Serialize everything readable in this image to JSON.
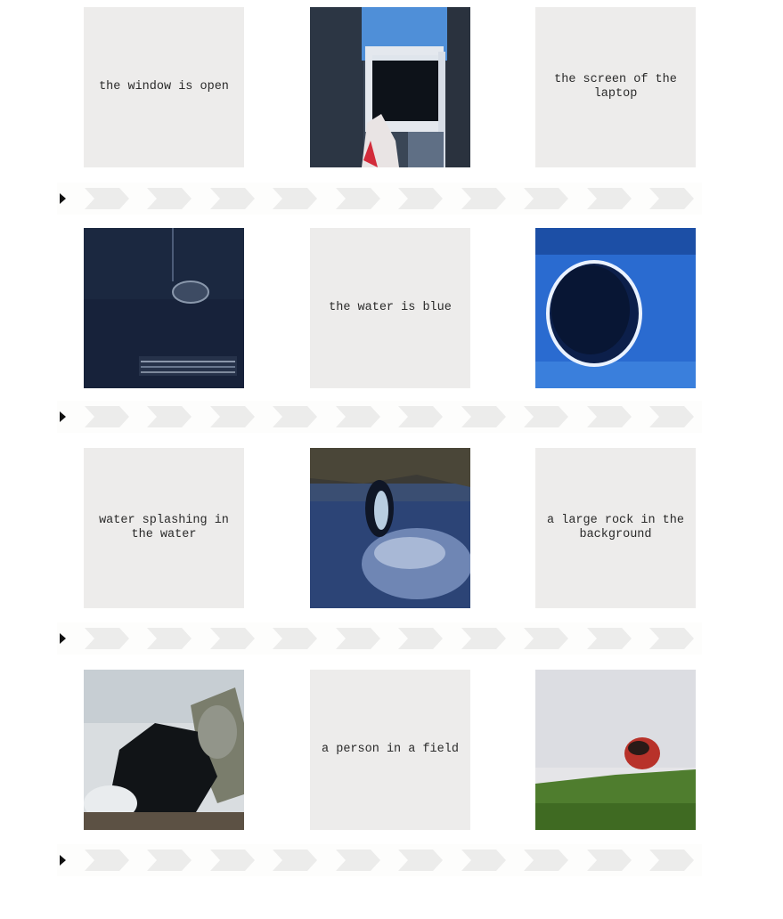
{
  "rows": [
    {
      "tiles": [
        {
          "kind": "text",
          "caption": "the window is open"
        },
        {
          "kind": "image",
          "image": "window-image"
        },
        {
          "kind": "text",
          "caption": "the screen of the\nlaptop"
        }
      ]
    },
    {
      "tiles": [
        {
          "kind": "image",
          "image": "dark-water-image"
        },
        {
          "kind": "text",
          "caption": "the water is blue"
        },
        {
          "kind": "image",
          "image": "blue-hole-image"
        }
      ]
    },
    {
      "tiles": [
        {
          "kind": "text",
          "caption": "water splashing in\nthe water"
        },
        {
          "kind": "image",
          "image": "bird-water-image"
        },
        {
          "kind": "text",
          "caption": "a large rock in the\nbackground"
        }
      ]
    },
    {
      "tiles": [
        {
          "kind": "image",
          "image": "rock-cloud-image"
        },
        {
          "kind": "text",
          "caption": "a person in a field"
        },
        {
          "kind": "image",
          "image": "field-rock-image"
        }
      ]
    }
  ],
  "strip": {
    "icon": "play-icon",
    "segments": 10
  },
  "colors": {
    "tile_bg": "#edeceb",
    "chevron": "#ececeb",
    "text": "#2a2a2a"
  }
}
